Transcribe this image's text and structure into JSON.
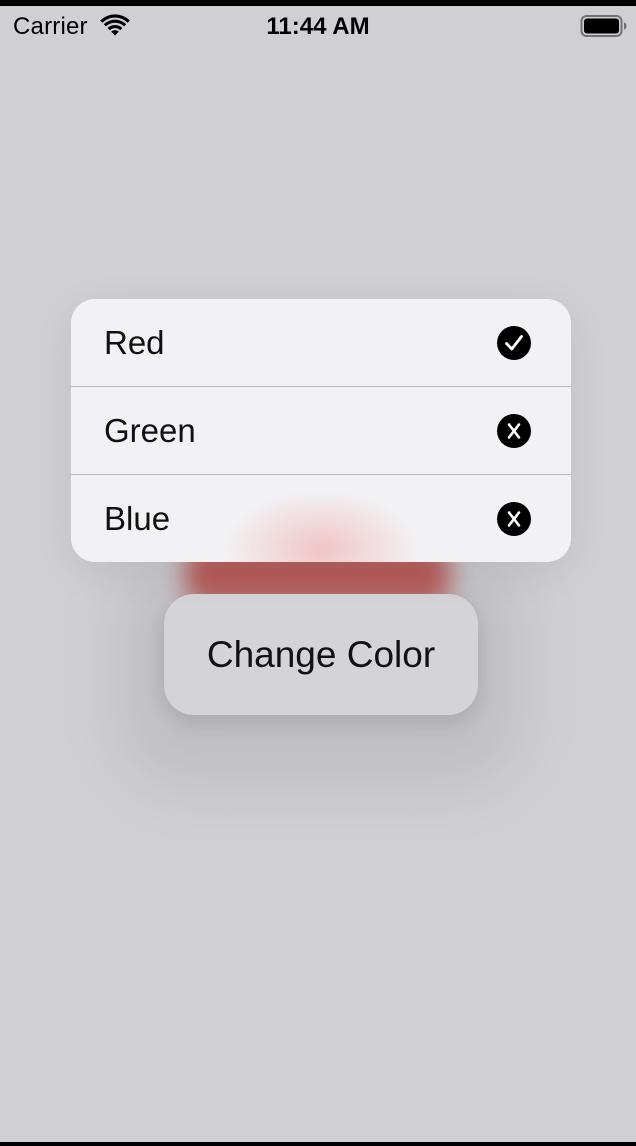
{
  "status_bar": {
    "carrier": "Carrier",
    "time": "11:44 AM",
    "wifi_icon": "wifi-icon",
    "battery_icon": "battery-full-icon"
  },
  "menu": {
    "items": [
      {
        "label": "Red",
        "icon": "checkmark-circle-icon",
        "selected": true
      },
      {
        "label": "Green",
        "icon": "xmark-circle-icon",
        "selected": false
      },
      {
        "label": "Blue",
        "icon": "xmark-circle-icon",
        "selected": false
      }
    ]
  },
  "button": {
    "label": "Change Color"
  },
  "colors": {
    "background": "#d0cfd4",
    "menu_background": "#f2f2f4",
    "accent_red": "#b24a47",
    "icon_fill": "#000000"
  }
}
